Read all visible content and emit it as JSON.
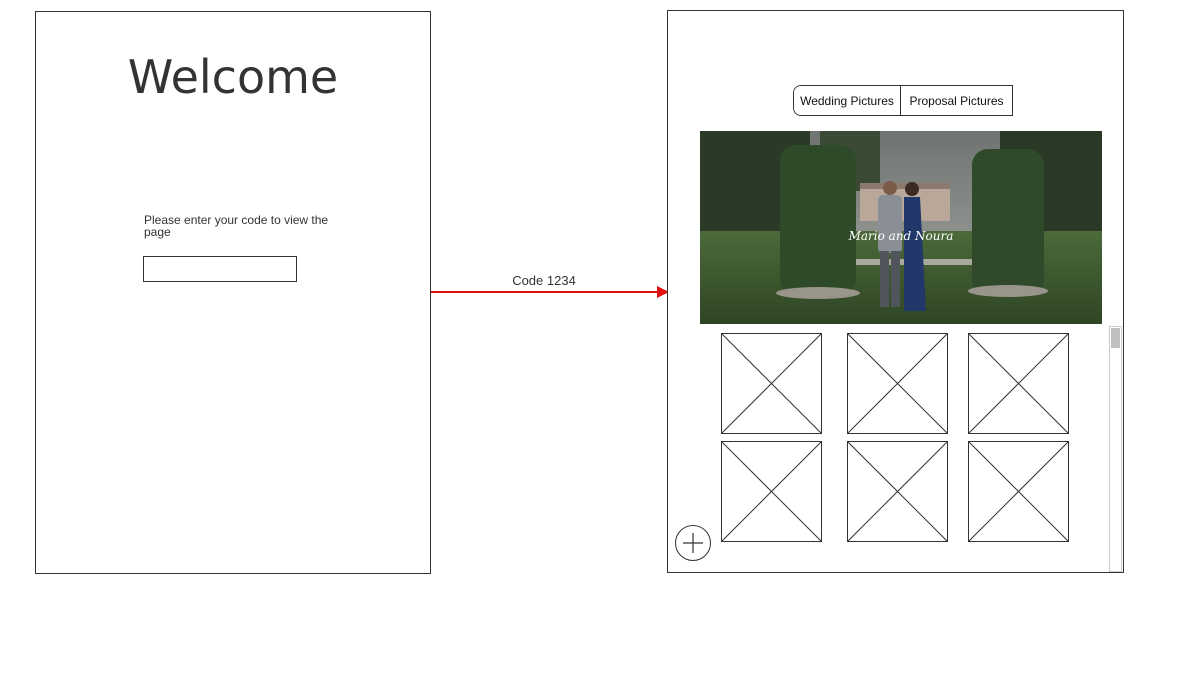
{
  "login_screen": {
    "title": "Welcome",
    "prompt": "Please enter your code to view the page",
    "code_input": {
      "value": "",
      "placeholder": ""
    }
  },
  "transition": {
    "label": "Code 1234",
    "color": "#e01010"
  },
  "gallery_screen": {
    "tabs": [
      {
        "label": "Wedding Pictures"
      },
      {
        "label": "Proposal Pictures"
      }
    ],
    "hero": {
      "caption": "Mario and Noura"
    },
    "photo_placeholders": 6,
    "add_button_icon": "plus-icon"
  }
}
